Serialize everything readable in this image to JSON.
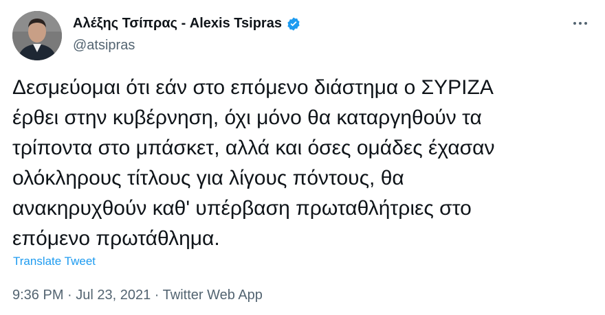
{
  "author": {
    "display_name": "Αλέξης Τσίπρας - Alexis Tsipras",
    "handle": "@atsipras",
    "verified": true
  },
  "icons": {
    "verified": "verified-badge-icon",
    "more": "more-options-icon"
  },
  "tweet": {
    "lines": [
      "Δεσμεύομαι ότι εάν στο επόμενο διάστημα ο ΣΥΡΙΖΑ",
      "έρθει στην κυβέρνηση, όχι μόνο θα καταργηθούν τα",
      "τρίποντα στο μπάσκετ, αλλά και όσες ομάδες έχασαν",
      "ολόκληρους τίτλους για λίγους πόντους, θα",
      "ανακηρυχθούν καθ' υπέρβαση πρωταθλήτριες στο",
      "επόμενο πρωτάθλημα."
    ],
    "translate_label": "Translate Tweet"
  },
  "meta": {
    "time": "9:36 PM",
    "separator": " · ",
    "date": "Jul 23, 2021",
    "source": "Twitter Web App"
  },
  "colors": {
    "text_primary": "#0f1419",
    "text_secondary": "#536471",
    "accent": "#1d9bf0"
  }
}
